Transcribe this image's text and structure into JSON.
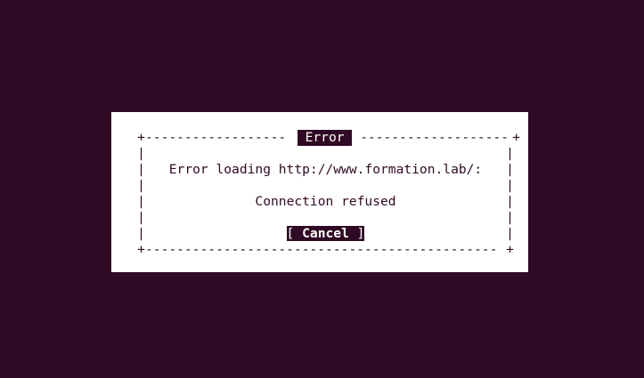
{
  "dialog": {
    "title": "Error",
    "message_line1": "Error loading http://www.formation.lab/:",
    "message_line2": "Connection refused",
    "button": {
      "open": "[",
      "label": "Cancel",
      "close": "]"
    }
  },
  "colors": {
    "background": "#300a24",
    "panel": "#ffffff",
    "text": "#300a24",
    "highlight": "#300a24"
  }
}
